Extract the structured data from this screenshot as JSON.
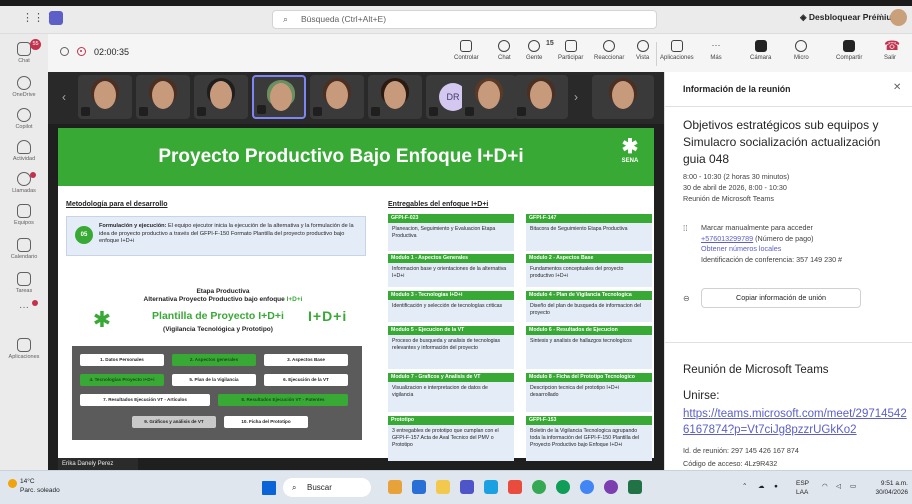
{
  "topbar": {
    "search_placeholder": "Búsqueda (Ctrl+Alt+E)",
    "premium_label": "Desbloquear Premium",
    "more": "···"
  },
  "rail": [
    {
      "label": "Chat",
      "badge": "55"
    },
    {
      "label": "OneDrive"
    },
    {
      "label": "Copilot"
    },
    {
      "label": "Actividad"
    },
    {
      "label": "Llamadas"
    },
    {
      "label": "Equipos"
    },
    {
      "label": "Calendario"
    },
    {
      "label": "Tareas"
    },
    {
      "label": "···"
    },
    {
      "label": "Aplicaciones"
    }
  ],
  "meeting": {
    "timer": "02:00:35",
    "people_count": "15",
    "controls": [
      "Controlar",
      "Chat",
      "Gente",
      "Participar",
      "Reaccionar",
      "Vista",
      "Aplicaciones",
      "Más",
      "Cámara",
      "Micro",
      "Compartir",
      "Salir"
    ]
  },
  "participants": {
    "initials": "DR",
    "presenter_name": "Erika Danely Perez"
  },
  "slide": {
    "title": "Proyecto Productivo Bajo Enfoque I+D+i",
    "logo_text": "SENA",
    "metodologia_heading": "Metodología para el desarrollo",
    "step_number": "05",
    "step_bold": "Formulación y ejecución:",
    "step_text": " El equipo ejecutor inicia la ejecución de la alternativa y la formulación de la idea de proyecto productivo a través del GFPI-F-150 Formato Plantilla del proyecto productivo bajo enfoque I+D+i",
    "etapa_title": "Etapa Productiva",
    "etapa_sub_prefix": "Alternativa Proyecto Productivo bajo enfoque ",
    "etapa_sub_highlight": "I+D+i",
    "plantilla_title": "Plantilla de Proyecto I+D+i",
    "plantilla_sub": "(Vigilancia Tecnológica y Prototipo)",
    "idi_mark": "I+D+i",
    "grid_buttons": [
      "1. Datos Personales",
      "2. Aspectos generales",
      "3. Aspectos Base",
      "4. Tecnologías Proyecto I+D+i",
      "5. Plan de la Vigilancia",
      "6. Ejecución de la VT",
      "7. Resultados Ejecución VT - Artículos",
      "8. Resultados Ejecución VT - Patentes",
      "9. Gráficos y análisis de VT",
      "10. Ficha del Prototipo"
    ],
    "entregables_heading": "Entregables del enfoque I+D+i",
    "entregables": [
      {
        "head": "GFPI-F-023",
        "body": "Planeacion, Seguimiento y Evaluacion Etapa Productiva"
      },
      {
        "head": "GFPI-F-147",
        "body": "Bitacora de Seguimiento Etapa Productiva"
      },
      {
        "head": "Modulo 1 - Aspectos Generales",
        "body": "Informacion base y orientaciones de la alternativa I+D+i"
      },
      {
        "head": "Modulo 2 - Aspectos Base",
        "body": "Fundamentos conceptuales del proyecto productivo I+D+i"
      },
      {
        "head": "Modulo 3 - Tecnologias I+D+i",
        "body": "Identificación y selección de tecnologías criticas"
      },
      {
        "head": "Modulo 4 - Plan de Vigilancia Tecnologica",
        "body": "Diseño del plan de busqueda de informacion del proyecto"
      },
      {
        "head": "Modulo 5 - Ejecucion de la VT",
        "body": "Proceso de busqueda y analisis de tecnologias relevantes y información del proyecto"
      },
      {
        "head": "Modulo 6 - Resultados de Ejecucion",
        "body": "Sintesis y analisis de hallazgos tecnologicos"
      },
      {
        "head": "Modulo 7 - Graficos y Analisis de VT",
        "body": "Visualizacion e interpretacion de datos de vigilancia"
      },
      {
        "head": "Modulo 8 - Ficha del Prototipo Tecnologico",
        "body": "Descripcion tecnica del prototipo I+D+i desarrollado"
      },
      {
        "head": "Prototipo",
        "body": "3 entregables de prototipo que cumplan con el GFPI-F-157 Acta de Aval Tecnico del PMV o Prototipo"
      },
      {
        "head": "GFPI-F-153",
        "body": "Boletin de la Vigilancia Tecnologica agrupando toda la información del GFPI-F-150 Plantilla del Proyecto Productivo bajo Enfoque I+D+i"
      }
    ]
  },
  "panel": {
    "header": "Información de la reunión",
    "title": "Objetivos estratégicos sub equipos y Simulacro socialización actualización guia 048",
    "time_line": "8:00 - 10:30 (2 horas 30 minutos)",
    "date_line": "30 de abril de 2026, 8:00 - 10:30",
    "platform_line": "Reunión de Microsoft Teams",
    "dial_label": "Marcar manualmente para acceder",
    "phone": "+576013299789",
    "phone_suffix": " (Número de pago)",
    "local_numbers": "Obtener números locales",
    "conference_id": "Identificación de conferencia: 357 149 230 #",
    "copy_button": "Copiar información de unión",
    "teams_heading": "Reunión de Microsoft Teams",
    "join_label": "Unirse:",
    "join_url": "https://teams.microsoft.com/meet/297145426167874?p=Vt7ciJg8pzzrUGkKo2",
    "meeting_id": "Id. de reunión: 297 145 426 167 874",
    "access_code": "Código de acceso: 4Lz9R432"
  },
  "taskbar": {
    "temp": "14°C",
    "weather": "Parc. soleado",
    "search": "Buscar",
    "lang": "ESP",
    "lang2": "LAA",
    "time": "9:51 a.m.",
    "date": "30/04/2026"
  },
  "colors": {
    "accent": "#5b5fc7",
    "sena_green": "#39a935",
    "leave_red": "#c4314b"
  }
}
